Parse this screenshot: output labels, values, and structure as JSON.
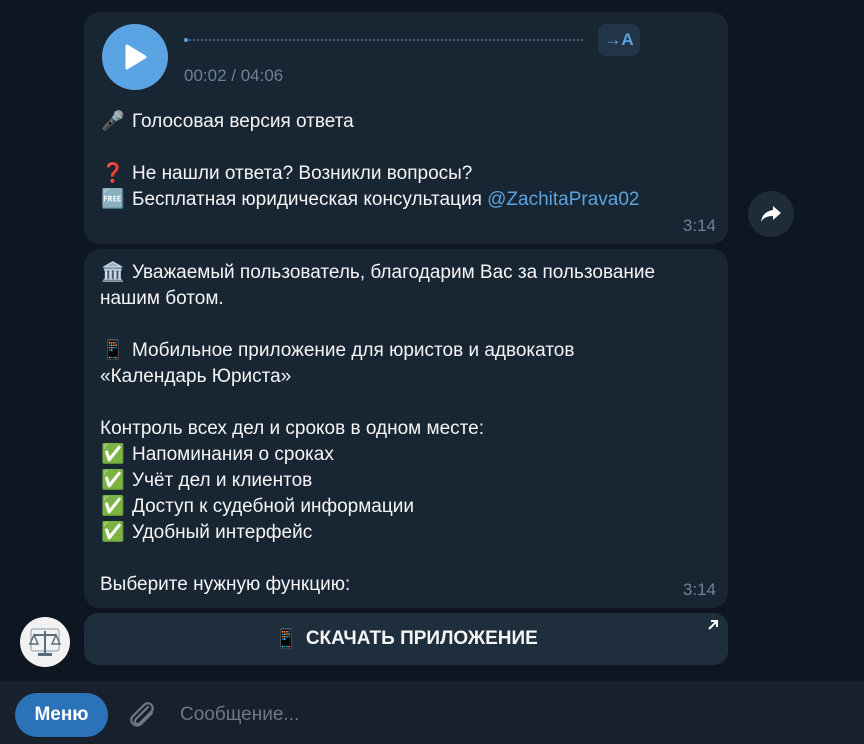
{
  "voice_message": {
    "time_display": "00:02 / 04:06",
    "progress": 0.01,
    "transcribe_label": "→A",
    "lines": [
      {
        "emoji": "🎤",
        "text": "Голосовая версия ответа"
      },
      {
        "emoji": "❓",
        "text": "Не нашли ответа? Возникли вопросы?"
      },
      {
        "emoji": "🆓",
        "text": "Бесплатная юридическая консультация ",
        "link": "@ZachitaPrava02"
      }
    ],
    "time": "3:14"
  },
  "bot_message": {
    "intro_emoji": "🏛️",
    "intro_line1": "Уважаемый пользователь, благодарим Вас за пользование",
    "intro_line2": "нашим ботом.",
    "app_emoji": "📱",
    "app_line1": "Мобильное приложение для юристов и адвокатов",
    "app_line2": "«Календарь Юриста»",
    "control_heading": "Контроль всех дел и сроков в одном месте:",
    "features": [
      {
        "emoji": "✅",
        "text": "Напоминания о сроках"
      },
      {
        "emoji": "✅",
        "text": "Учёт дел и клиентов"
      },
      {
        "emoji": "✅",
        "text": "Доступ к судебной информации"
      },
      {
        "emoji": "✅",
        "text": "Удобный интерфейс"
      }
    ],
    "prompt": "Выберите нужную функцию:",
    "time": "3:14"
  },
  "inline_button": {
    "emoji": "📱",
    "label": "СКАЧАТЬ ПРИЛОЖЕНИЕ"
  },
  "composer": {
    "menu_label": "Меню",
    "placeholder": "Сообщение..."
  },
  "colors": {
    "background": "#0e1621",
    "bubble": "#182533",
    "accent": "#5aa4e3",
    "menu_button": "#2b72b8"
  },
  "icons": {
    "play": "play-icon",
    "forward": "share-arrow-icon",
    "attach": "paperclip-icon",
    "link_out": "arrow-up-right-icon",
    "avatar": "scales-of-justice-icon"
  }
}
